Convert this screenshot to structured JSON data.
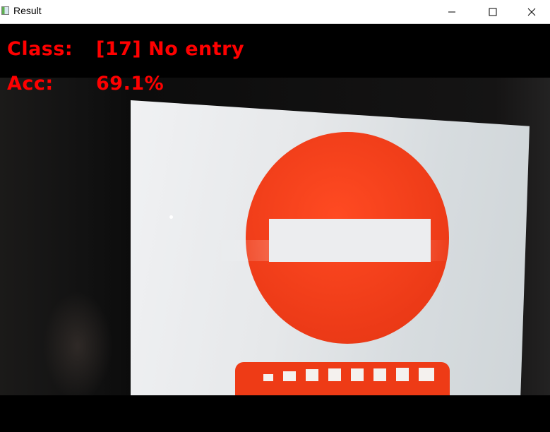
{
  "window": {
    "title": "Result",
    "icon": "app-window-icon",
    "controls": [
      "minimize-icon",
      "maximize-icon",
      "close-icon"
    ]
  },
  "overlay": {
    "class_label": "Class:",
    "class_value": "[17] No entry",
    "acc_label": "Acc:",
    "acc_value": "69.1%",
    "text_color": "#ff0000"
  },
  "scene": {
    "sign_color": "#ec3a17",
    "board_color": "#e6e8ea"
  }
}
